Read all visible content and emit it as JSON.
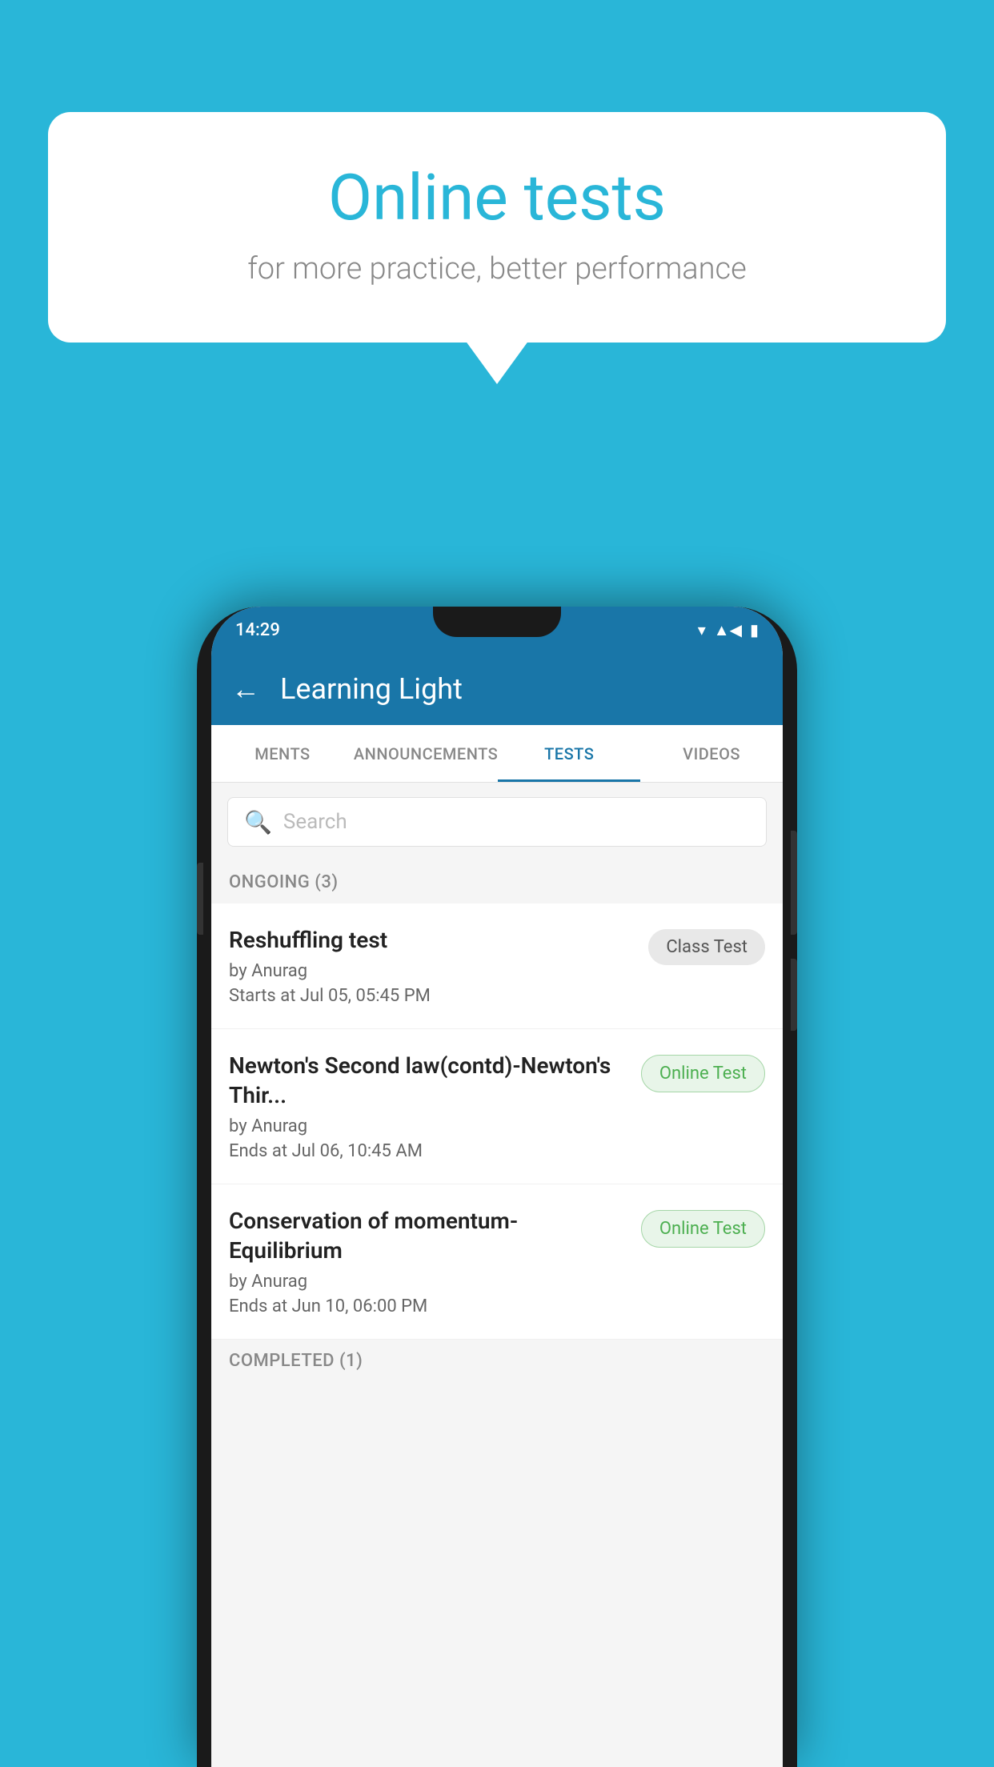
{
  "background_color": "#29b6d8",
  "speech_bubble": {
    "title": "Online tests",
    "subtitle": "for more practice, better performance"
  },
  "phone": {
    "status_bar": {
      "time": "14:29",
      "wifi": "▾",
      "signal": "▲",
      "battery": "▮"
    },
    "app_bar": {
      "back_icon": "←",
      "title": "Learning Light"
    },
    "tabs": [
      {
        "label": "MENTS",
        "active": false
      },
      {
        "label": "ANNOUNCEMENTS",
        "active": false
      },
      {
        "label": "TESTS",
        "active": true
      },
      {
        "label": "VIDEOS",
        "active": false
      }
    ],
    "search": {
      "placeholder": "Search",
      "icon": "🔍"
    },
    "sections": [
      {
        "header": "ONGOING (3)",
        "tests": [
          {
            "name": "Reshuffling test",
            "by": "by Anurag",
            "time_label": "Starts at",
            "time": "Jul 05, 05:45 PM",
            "badge": "Class Test",
            "badge_type": "class"
          },
          {
            "name": "Newton's Second law(contd)-Newton's Thir...",
            "by": "by Anurag",
            "time_label": "Ends at",
            "time": "Jul 06, 10:45 AM",
            "badge": "Online Test",
            "badge_type": "online"
          },
          {
            "name": "Conservation of momentum-Equilibrium",
            "by": "by Anurag",
            "time_label": "Ends at",
            "time": "Jun 10, 06:00 PM",
            "badge": "Online Test",
            "badge_type": "online"
          }
        ]
      }
    ],
    "completed_label": "COMPLETED (1)"
  }
}
